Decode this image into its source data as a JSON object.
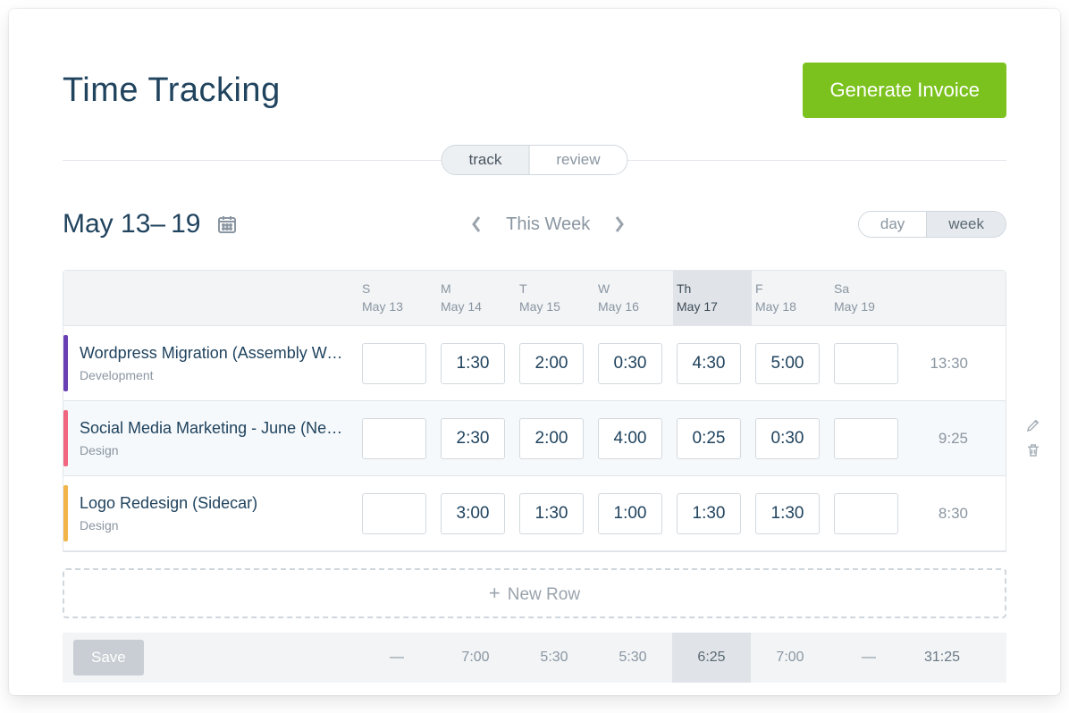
{
  "header": {
    "title": "Time Tracking",
    "generate_label": "Generate Invoice"
  },
  "mode_seg": {
    "track": "track",
    "review": "review",
    "active": "track"
  },
  "range": {
    "label": "May 13– 19",
    "nav_label": "This Week"
  },
  "view_seg": {
    "day": "day",
    "week": "week",
    "active": "week"
  },
  "days": [
    {
      "dow": "S",
      "label": "May 13"
    },
    {
      "dow": "M",
      "label": "May 14"
    },
    {
      "dow": "T",
      "label": "May 15"
    },
    {
      "dow": "W",
      "label": "May 16"
    },
    {
      "dow": "Th",
      "label": "May 17",
      "active": true
    },
    {
      "dow": "F",
      "label": "May 18"
    },
    {
      "dow": "Sa",
      "label": "May 19"
    }
  ],
  "rows": [
    {
      "color": "#6a3fb5",
      "name": "Wordpress Migration (Assembly We…",
      "category": "Development",
      "cells": [
        "",
        "1:30",
        "2:00",
        "0:30",
        "4:30",
        "5:00",
        ""
      ],
      "total": "13:30"
    },
    {
      "color": "#f0667f",
      "name": "Social Media Marketing - June (Neu…)",
      "category": "Design",
      "cells": [
        "",
        "2:30",
        "2:00",
        "4:00",
        "0:25",
        "0:30",
        ""
      ],
      "total": "9:25",
      "hover": true
    },
    {
      "color": "#f2b54a",
      "name": "Logo Redesign (Sidecar)",
      "category": "Design",
      "cells": [
        "",
        "3:00",
        "1:30",
        "1:00",
        "1:30",
        "1:30",
        ""
      ],
      "total": "8:30"
    }
  ],
  "new_row_label": "New Row",
  "footer": {
    "save_label": "Save",
    "totals": [
      "—",
      "7:00",
      "5:30",
      "5:30",
      "6:25",
      "7:00",
      "—"
    ],
    "grand_total": "31:25"
  }
}
